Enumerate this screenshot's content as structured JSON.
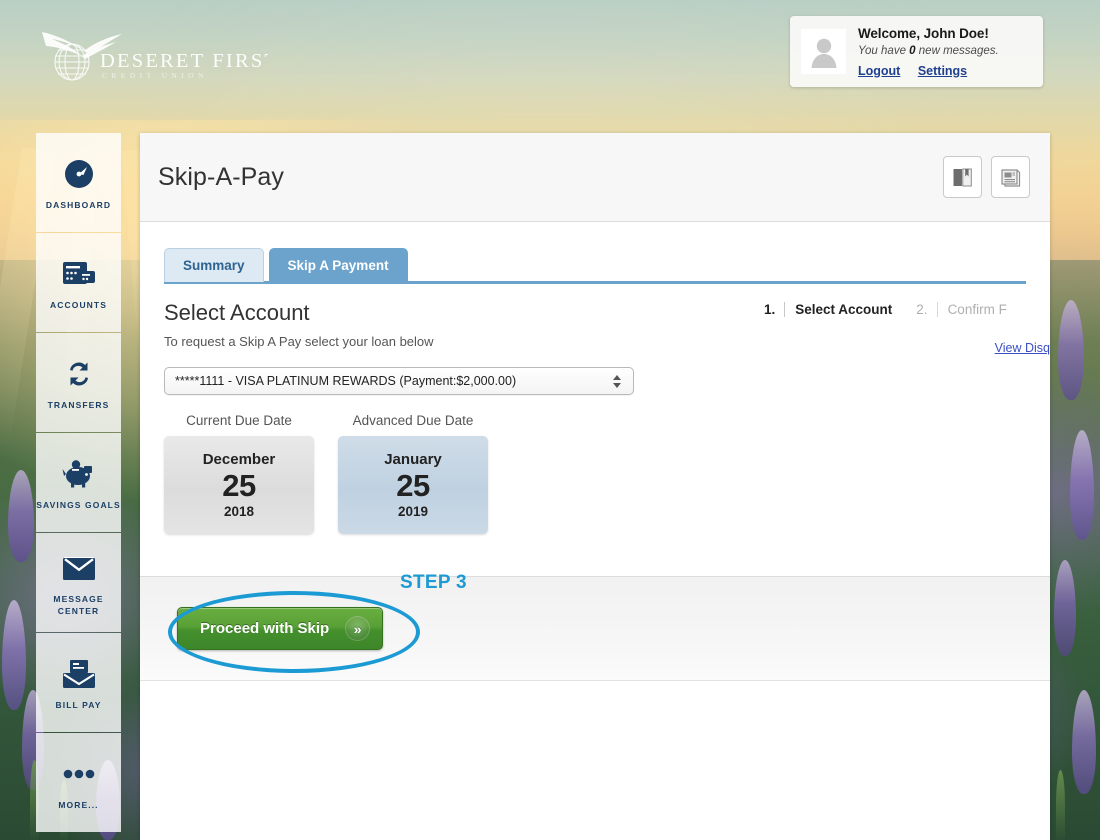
{
  "brand": {
    "logo_name": "Deseret First Credit Union",
    "logo_title": "DESERET FIRST",
    "logo_subtitle": "CREDIT UNION"
  },
  "welcome": {
    "greeting_prefix": "Welcome,",
    "user_name": "John Doe!",
    "messages_prefix": "You have",
    "messages_count": "0",
    "messages_suffix": "new messages.",
    "logout_label": "Logout",
    "settings_label": "Settings"
  },
  "sidebar": {
    "items": [
      {
        "label": "Dashboard",
        "icon": "speedometer-icon"
      },
      {
        "label": "Accounts",
        "icon": "wallet-icon"
      },
      {
        "label": "Transfers",
        "icon": "transfer-arrows-icon"
      },
      {
        "label": "Savings Goals",
        "icon": "piggy-bank-icon"
      },
      {
        "label": "Message Center",
        "icon": "envelope-icon"
      },
      {
        "label": "Bill Pay",
        "icon": "bill-envelope-icon"
      },
      {
        "label": "More...",
        "icon": "ellipsis-icon"
      }
    ]
  },
  "header": {
    "title": "Skip-A-Pay",
    "actions": [
      {
        "name": "guide-button",
        "icon": "open-book-icon"
      },
      {
        "name": "print-button",
        "icon": "document-print-icon"
      }
    ]
  },
  "tabs": [
    {
      "label": "Summary",
      "active": false
    },
    {
      "label": "Skip A Payment",
      "active": true
    }
  ],
  "section": {
    "heading": "Select Account",
    "subtitle": "To request a Skip A Pay select your loan below"
  },
  "steps": [
    {
      "number": "1.",
      "name": "Select Account",
      "active": true
    },
    {
      "number": "2.",
      "name": "Confirm F",
      "active": false
    }
  ],
  "disclosure": {
    "link_label": "View Disq"
  },
  "account_select": {
    "value": "*****1111 - VISA PLATINUM REWARDS (Payment:$2,000.00)",
    "masked_number": "*****1111",
    "account_name": "VISA PLATINUM REWARDS",
    "payment_label": "Payment:",
    "payment_amount": "$2,000.00"
  },
  "dates": [
    {
      "caption": "Current Due Date",
      "month": "December",
      "day": "25",
      "year": "2018",
      "style": "current"
    },
    {
      "caption": "Advanced Due Date",
      "month": "January",
      "day": "25",
      "year": "2019",
      "style": "advanced"
    }
  ],
  "action": {
    "proceed_label": "Proceed with Skip",
    "proceed_chevron": "»"
  },
  "annotation": {
    "step_badge": "STEP 3",
    "highlight_shape": "ellipse"
  },
  "colors": {
    "accent_blue": "#1b9ad4",
    "tab_active": "#6ba3cd",
    "tab_inactive": "#dde9f3",
    "nav_navy": "#1c3f66",
    "button_green": "#4c972f",
    "link_blue": "#1f3f8f",
    "disclosure_link": "#3b4fc4"
  }
}
